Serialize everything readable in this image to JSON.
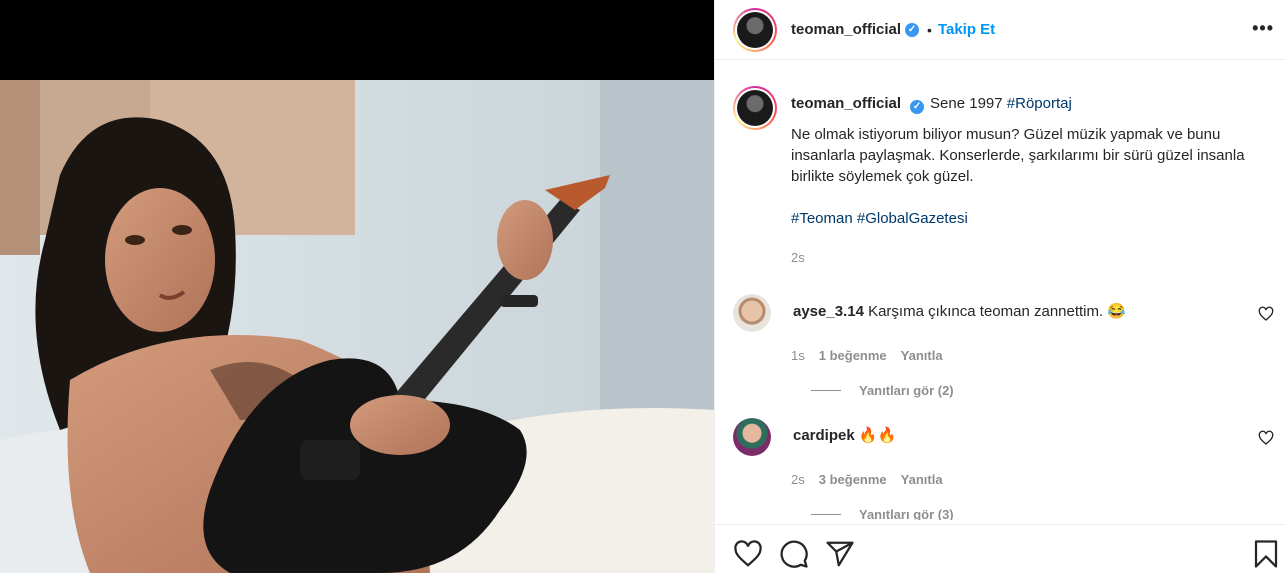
{
  "post": {
    "username": "teoman_official",
    "verified_mark": "✓",
    "follow_label": "Takip Et",
    "dot": "•",
    "more_label": "•••"
  },
  "caption": {
    "username": "teoman_official",
    "lead": "Sene 1997",
    "lead_tag": "#Röportaj",
    "body": "Ne olmak istiyorum biliyor musun? Güzel müzik yapmak ve bunu insanlarla paylaşmak. Konserlerde, şarkılarımı bir sürü güzel insanla birlikte söylemek çok güzel.",
    "tags": "#Teoman #GlobalGazetesi",
    "time": "2s"
  },
  "comments": [
    {
      "username": "ayse_3.14",
      "text": "Karşıma çıkınca teoman zannettim. 😂",
      "time": "1s",
      "likes": "1 beğenme",
      "reply": "Yanıtla",
      "view_replies": "Yanıtları gör (2)"
    },
    {
      "username": "cardipek",
      "text": "🔥🔥",
      "time": "2s",
      "likes": "3 beğenme",
      "reply": "Yanıtla",
      "view_replies": "Yanıtları gör (3)"
    }
  ],
  "icons": {
    "like": "heart-icon",
    "comment": "comment-icon",
    "share": "share-icon",
    "save": "bookmark-icon"
  },
  "colors": {
    "link": "#0095f6",
    "hashtag": "#00376b",
    "muted": "#8e8e8e"
  }
}
